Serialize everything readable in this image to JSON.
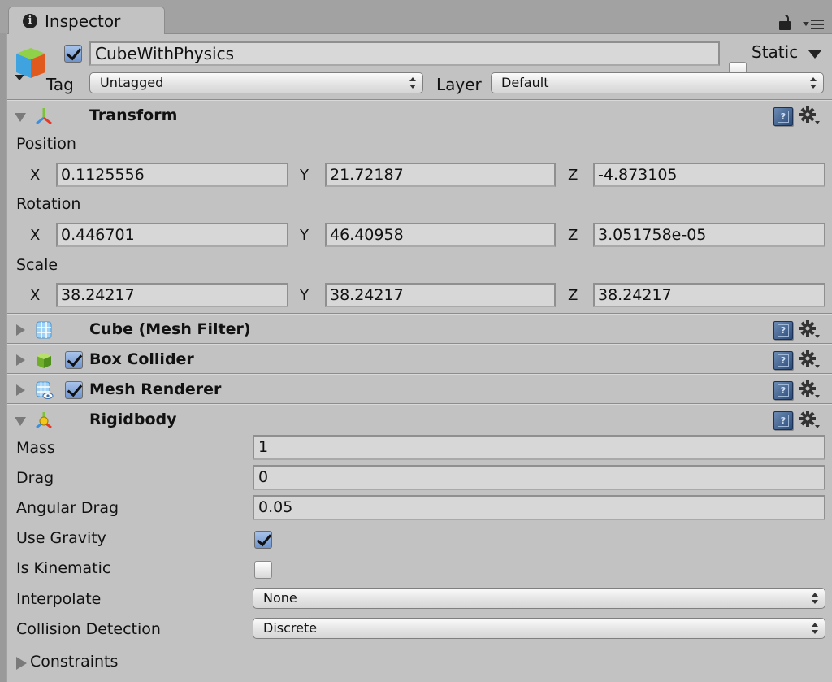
{
  "window": {
    "tab_title": "Inspector",
    "tab_icon": "info-icon",
    "lock_icon": "lock-icon",
    "menu_icon": "panel-menu-icon"
  },
  "gameobject": {
    "icon": "gameobject-cube-icon",
    "active": true,
    "name": "CubeWithPhysics",
    "static_label": "Static",
    "static": false,
    "tag_label": "Tag",
    "tag_value": "Untagged",
    "layer_label": "Layer",
    "layer_value": "Default"
  },
  "transform": {
    "title": "Transform",
    "expanded": true,
    "icon": "transform-axes-icon",
    "position_label": "Position",
    "rotation_label": "Rotation",
    "scale_label": "Scale",
    "axis_labels": {
      "x": "X",
      "y": "Y",
      "z": "Z"
    },
    "position": {
      "x": "0.1125556",
      "y": "21.72187",
      "z": "-4.873105"
    },
    "rotation": {
      "x": "0.446701",
      "y": "46.40958",
      "z": "3.051758e-05"
    },
    "scale": {
      "x": "38.24217",
      "y": "38.24217",
      "z": "38.24217"
    }
  },
  "components": [
    {
      "title": "Cube (Mesh Filter)",
      "icon": "mesh-filter-icon",
      "expanded": false,
      "has_checkbox": false
    },
    {
      "title": "Box Collider",
      "icon": "box-collider-icon",
      "expanded": false,
      "has_checkbox": true,
      "enabled": true
    },
    {
      "title": "Mesh Renderer",
      "icon": "mesh-renderer-icon",
      "expanded": false,
      "has_checkbox": true,
      "enabled": true
    }
  ],
  "rigidbody": {
    "title": "Rigidbody",
    "icon": "rigidbody-icon",
    "expanded": true,
    "mass_label": "Mass",
    "mass": "1",
    "drag_label": "Drag",
    "drag": "0",
    "angular_drag_label": "Angular Drag",
    "angular_drag": "0.05",
    "use_gravity_label": "Use Gravity",
    "use_gravity": true,
    "is_kinematic_label": "Is Kinematic",
    "is_kinematic": false,
    "interpolate_label": "Interpolate",
    "interpolate": "None",
    "collision_detection_label": "Collision Detection",
    "collision_detection": "Discrete",
    "constraints_label": "Constraints",
    "constraints_expanded": false
  },
  "header_buttons": {
    "help_glyph": "?",
    "help_icon": "help-book-icon",
    "settings_icon": "gear-icon"
  },
  "colors": {
    "panel_bg": "#c2c2c2",
    "field_bg": "#d7d7d7",
    "checkbox_on": "#7b9fd4",
    "separator": "#8c8c8c"
  }
}
